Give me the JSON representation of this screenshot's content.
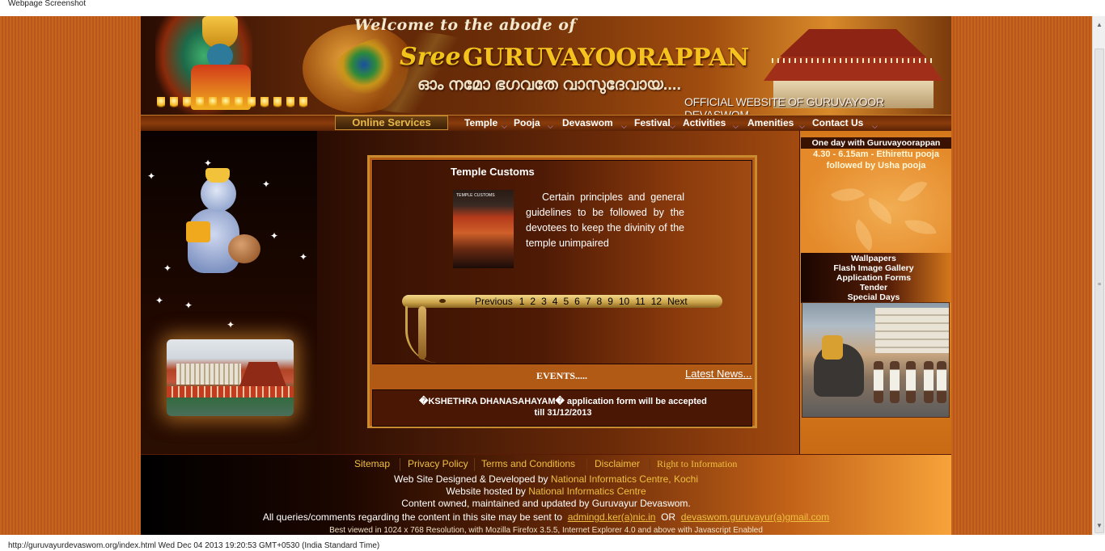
{
  "window": {
    "caption": "Webpage Screenshot",
    "status_url": "http://guruvayurdevaswom.org/index.html Wed Dec 04 2013 19:20:53 GMT+0530 (India Standard Time)"
  },
  "header": {
    "welcome": "Welcome to the abode of",
    "title_prefix": "Sree",
    "title_main": "GURUVAYOORAPPAN",
    "malayalam": "ഓം നമോ ഭഗവതേ വാസുദേവായ....",
    "official": "OFFICIAL WEBSITE OF GURUVAYOOR DEVASWOM"
  },
  "nav": {
    "online_services": "Online Services",
    "items": [
      "Temple",
      "Pooja",
      "Devaswom",
      "Festival",
      "Activities",
      "Amenities",
      "Contact Us"
    ]
  },
  "main": {
    "customs_title": "Temple Customs",
    "thumb_label": "TEMPLE CUSTOMS",
    "customs_text": "Certain principles and general guidelines to be followed by the devotees to keep the divinity of the temple unimpaired",
    "pager": {
      "previous": "Previous",
      "pages": [
        "1",
        "2",
        "3",
        "4",
        "5",
        "6",
        "7",
        "8",
        "9",
        "10",
        "11",
        "12"
      ],
      "next": "Next"
    },
    "events_label": "EVENTS.....",
    "latest_news": "Latest News...",
    "news_line1": "�KSHETHRA DHANASAHAYAM� application form will be accepted",
    "news_line2": "till 31/12/2013"
  },
  "right": {
    "oneday_title": "One day with Guruvayoorappan",
    "oneday_line1": "4.30 - 6.15am - Ethirettu pooja",
    "oneday_line2": "followed by Usha pooja",
    "links": [
      "Wallpapers",
      "Flash Image Gallery",
      "Application Forms",
      "Tender",
      "Special Days"
    ]
  },
  "footer": {
    "links": [
      "Sitemap",
      "Privacy Policy",
      "Terms and Conditions",
      "Disclaimer",
      "Right to Information"
    ],
    "designed_prefix": "Web Site Designed & Developed by",
    "designed_by": "National Informatics Centre, Kochi",
    "hosted_prefix": "Website hosted by",
    "hosted_by": "National Informatics Centre",
    "content_owned": "Content owned, maintained and updated by Guruvayur Devaswom.",
    "queries_prefix": "All queries/comments regarding the content in this site may be sent to",
    "email1": "admingd.ker(a)nic.in",
    "or_text": "OR",
    "email2": "devaswom.guruvayur(a)gmail.com",
    "best_viewed": "Best viewed in 1024 x 768 Resolution, with Mozilla Firefox 3.5.5, Internet Explorer 4.0 and above with Javascript Enabled"
  }
}
